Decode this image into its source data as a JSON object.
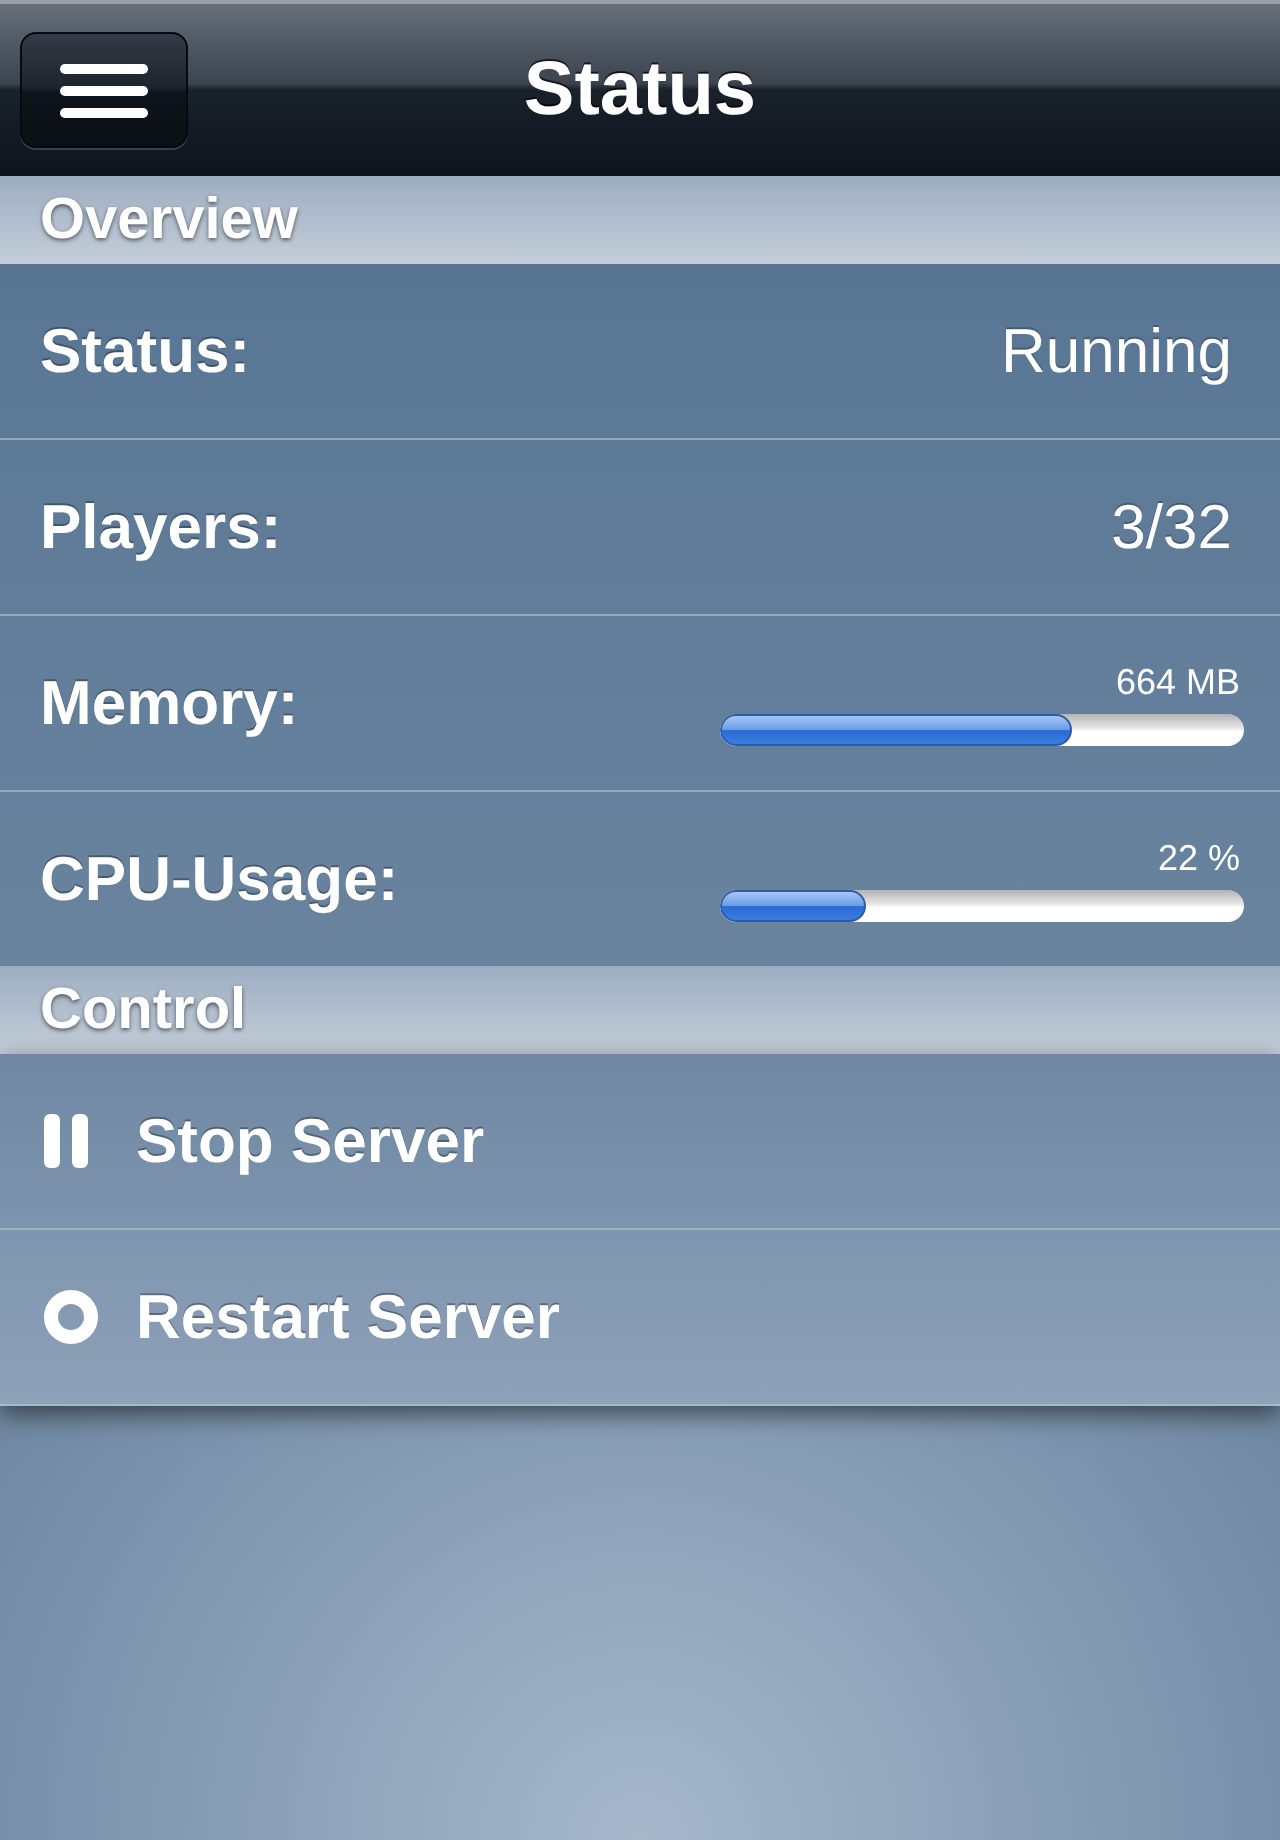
{
  "nav_bar": {
    "title": "Status"
  },
  "sections": [
    {
      "title": "Overview",
      "rows": [
        {
          "kind": "text",
          "label": "Status:",
          "value": "Running"
        },
        {
          "kind": "text",
          "label": "Players:",
          "value": "3/32"
        },
        {
          "kind": "meter",
          "label": "Memory:",
          "reading": "664 MB",
          "level": 0.67
        },
        {
          "kind": "meter",
          "label": "CPU-Usage:",
          "reading": "22 %",
          "level": 0.28
        }
      ]
    },
    {
      "title": "Control",
      "rows": [
        {
          "kind": "stop",
          "label": "Stop Server"
        },
        {
          "kind": "restart",
          "label": "Restart Server"
        }
      ]
    }
  ]
}
